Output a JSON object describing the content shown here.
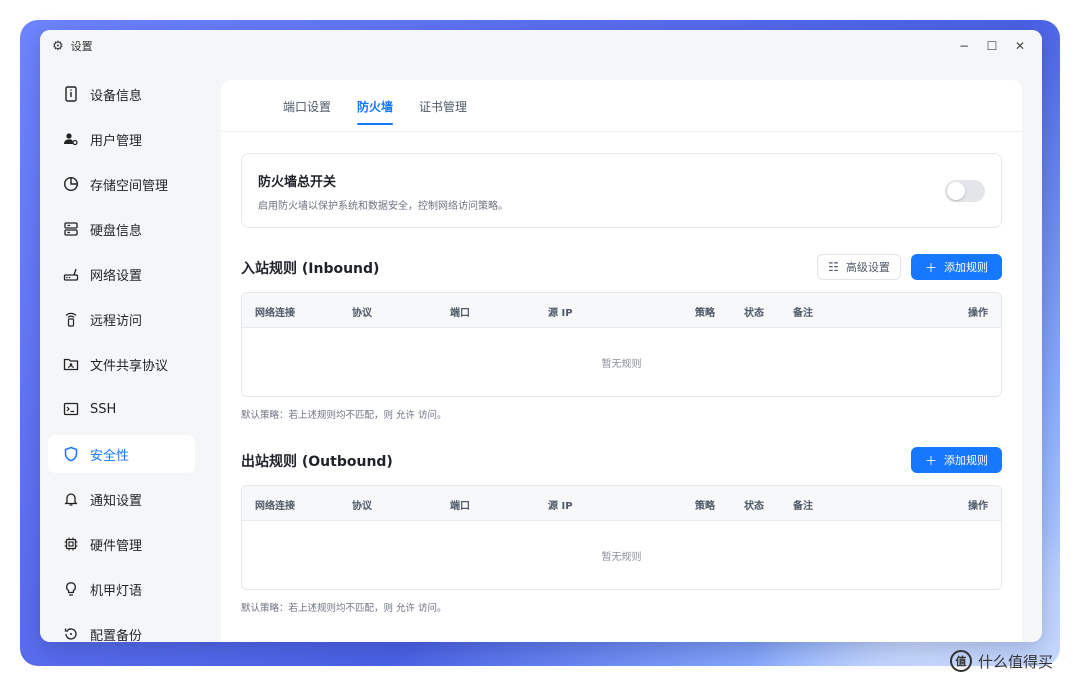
{
  "window": {
    "title": "设置",
    "icon": "gear-icon"
  },
  "window_controls": {
    "minimize": "−",
    "maximize": "☐",
    "close": "✕"
  },
  "sidebar": {
    "items": [
      {
        "label": "设备信息",
        "icon": "device-info-icon"
      },
      {
        "label": "用户管理",
        "icon": "user-settings-icon"
      },
      {
        "label": "存储空间管理",
        "icon": "pie-chart-icon"
      },
      {
        "label": "硬盘信息",
        "icon": "disk-icon"
      },
      {
        "label": "网络设置",
        "icon": "router-icon"
      },
      {
        "label": "远程访问",
        "icon": "remote-access-icon"
      },
      {
        "label": "文件共享协议",
        "icon": "shared-folder-icon"
      },
      {
        "label": "SSH",
        "icon": "terminal-icon"
      },
      {
        "label": "安全性",
        "icon": "shield-icon",
        "active": true
      },
      {
        "label": "通知设置",
        "icon": "bell-icon"
      },
      {
        "label": "硬件管理",
        "icon": "chip-icon"
      },
      {
        "label": "机甲灯语",
        "icon": "bulb-icon"
      },
      {
        "label": "配置备份",
        "icon": "backup-icon"
      }
    ]
  },
  "tabs": [
    {
      "label": "端口设置"
    },
    {
      "label": "防火墙",
      "active": true
    },
    {
      "label": "证书管理"
    }
  ],
  "firewall_switch": {
    "title": "防火墙总开关",
    "description": "启用防火墙以保护系统和数据安全，控制网络访问策略。",
    "enabled": false
  },
  "inbound": {
    "title": "入站规则 (Inbound)",
    "advanced_label": "高级设置",
    "add_label": "添加规则",
    "columns": [
      "网络连接",
      "协议",
      "端口",
      "源 IP",
      "策略",
      "状态",
      "备注",
      "操作"
    ],
    "empty_text": "暂无规则",
    "default_policy": "默认策略：若上述规则均不匹配，则 允许 访问。"
  },
  "outbound": {
    "title": "出站规则 (Outbound)",
    "add_label": "添加规则",
    "columns": [
      "网络连接",
      "协议",
      "端口",
      "源 IP",
      "策略",
      "状态",
      "备注",
      "操作"
    ],
    "empty_text": "暂无规则",
    "default_policy": "默认策略：若上述规则均不匹配，则 允许 访问。"
  },
  "watermark": {
    "text": "什么值得买",
    "logo": "值"
  },
  "colors": {
    "accent": "#1677ff",
    "toggle_off": "#e3e5e9",
    "sidebar_bg": "#f5f6f8"
  }
}
